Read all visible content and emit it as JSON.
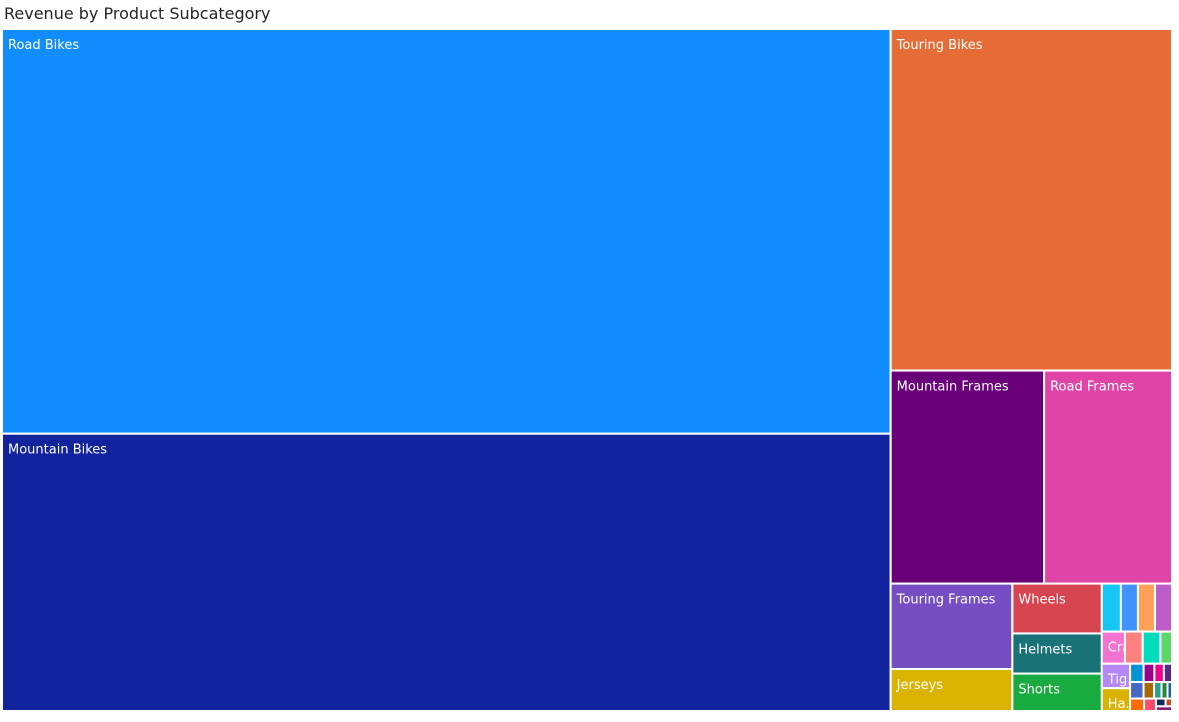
{
  "chart_data": {
    "type": "treemap",
    "title": "Revenue by Product Subcategory",
    "items": [
      {
        "label": "Road Bikes",
        "value": 14520,
        "color": "#118DFF"
      },
      {
        "label": "Mountain Bikes",
        "value": 9950,
        "color": "#12239E"
      },
      {
        "label": "Touring Bikes",
        "value": 3880,
        "color": "#E66C37"
      },
      {
        "label": "Mountain Frames",
        "value": 1320,
        "color": "#6B007B"
      },
      {
        "label": "Road Frames",
        "value": 1100,
        "color": "#E044A7"
      },
      {
        "label": "Touring Frames",
        "value": 420,
        "color": "#744EC2"
      },
      {
        "label": "Jerseys",
        "value": 206,
        "color": "#D9B300"
      },
      {
        "label": "Wheels",
        "value": 180,
        "color": "#D64550"
      },
      {
        "label": "Helmets",
        "value": 145,
        "color": "#197278"
      },
      {
        "label": "Shorts",
        "value": 135,
        "color": "#1AAB40"
      },
      {
        "label": "",
        "value": 37,
        "color": "#15C6F4"
      },
      {
        "label": "",
        "value": 33,
        "color": "#4092FF"
      },
      {
        "label": "",
        "value": 33,
        "color": "#FFA058"
      },
      {
        "label": "",
        "value": 33,
        "color": "#BE5DC9"
      },
      {
        "label": "Cra...",
        "value": 30,
        "color": "#F472D0"
      },
      {
        "label": "",
        "value": 23,
        "color": "#FF8080"
      },
      {
        "label": "",
        "value": 23,
        "color": "#00DBBC"
      },
      {
        "label": "",
        "value": 15,
        "color": "#5BD667"
      },
      {
        "label": "Tig...",
        "value": 28,
        "color": "#B687F7"
      },
      {
        "label": "Ha...",
        "value": 26,
        "color": "#D9B300"
      },
      {
        "label": "",
        "value": 10,
        "color": "#0093D5"
      },
      {
        "label": "",
        "value": 8,
        "color": "#9A0089"
      },
      {
        "label": "",
        "value": 7,
        "color": "#EC008C"
      },
      {
        "label": "",
        "value": 6,
        "color": "#582A7F"
      },
      {
        "label": "",
        "value": 9,
        "color": "#4668C5"
      },
      {
        "label": "",
        "value": 7,
        "color": "#A66A00"
      },
      {
        "label": "",
        "value": 5,
        "color": "#2E9E8F"
      },
      {
        "label": "",
        "value": 4,
        "color": "#248A3C"
      },
      {
        "label": "",
        "value": 3,
        "color": "#1F5FA8"
      },
      {
        "label": "",
        "value": 7,
        "color": "#FF6B00"
      },
      {
        "label": "",
        "value": 6,
        "color": "#FF4D6A"
      },
      {
        "label": "",
        "value": 3,
        "color": "#0E2A5C"
      },
      {
        "label": "",
        "value": 2,
        "color": "#C94A1F"
      },
      {
        "label": "",
        "value": 3,
        "color": "#8A1C7C"
      }
    ]
  }
}
